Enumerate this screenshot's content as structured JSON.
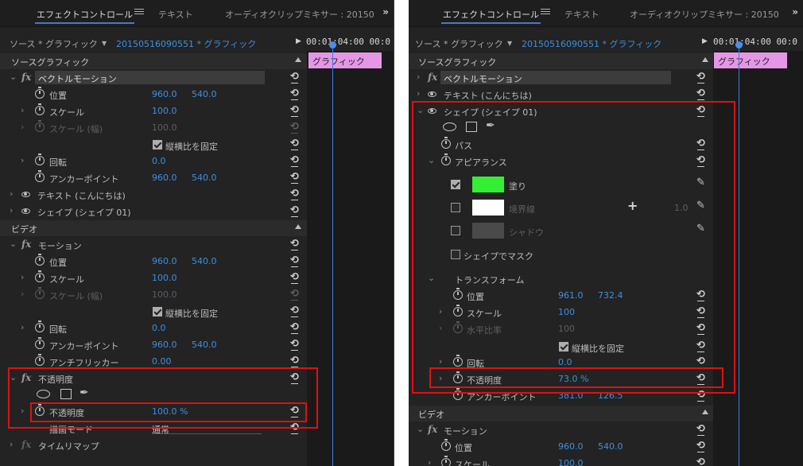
{
  "tabs": {
    "effect_controls": "エフェクトコントロール",
    "text": "テキスト",
    "audio_mixer_left": "オーディオクリップミキサー : 20150",
    "audio_mixer_right": "オーディオクリップミキサー : 20150"
  },
  "source": {
    "prefix": "ソース * グラフィック",
    "clip": "20150516090551 * グラフィック",
    "timecode_left": "00:01:04:00 00:0",
    "timecode_right": "00:01:04:00 00:0"
  },
  "timeline_clip": "グラフィック",
  "left": {
    "source_graphic": "ソースグラフィック",
    "vector_motion": "ベクトルモーション",
    "position": "位置",
    "position_x": "960.0",
    "position_y": "540.0",
    "scale": "スケール",
    "scale_value": "100.0",
    "scale_width": "スケール (幅)",
    "scale_width_value": "100.0",
    "uniform_scale": "縦横比を固定",
    "rotation": "回転",
    "rotation_value": "0.0",
    "anchor": "アンカーポイント",
    "anchor_x": "960.0",
    "anchor_y": "540.0",
    "text_layer": "テキスト (こんにちは)",
    "shape_layer": "シェイプ (シェイプ 01)",
    "video": "ビデオ",
    "motion": "モーション",
    "m_position": "位置",
    "m_position_x": "960.0",
    "m_position_y": "540.0",
    "m_scale": "スケール",
    "m_scale_value": "100.0",
    "m_scale_width": "スケール (幅)",
    "m_scale_width_value": "100.0",
    "m_uniform": "縦横比を固定",
    "m_rotation": "回転",
    "m_rotation_value": "0.0",
    "m_anchor": "アンカーポイント",
    "m_anchor_x": "960.0",
    "m_anchor_y": "540.0",
    "antiflicker": "アンチフリッカー",
    "antiflicker_value": "0.00",
    "opacity_group": "不透明度",
    "opacity": "不透明度",
    "opacity_value": "100.0 %",
    "blend_mode": "描画モード",
    "blend_value": "通常",
    "time_remap": "タイムリマップ"
  },
  "right": {
    "source_graphic": "ソースグラフィック",
    "vector_motion": "ベクトルモーション",
    "text_layer": "テキスト (こんにちは)",
    "shape_layer": "シェイプ (シェイプ 01)",
    "path": "パス",
    "appearance": "アピアランス",
    "fill": "塗り",
    "stroke": "境界線",
    "stroke_width": "1.0",
    "shadow": "シャドウ",
    "shape_mask": "シェイプでマスク",
    "transform": "トランスフォーム",
    "position": "位置",
    "position_x": "961.0",
    "position_y": "732.4",
    "scale": "スケール",
    "scale_value": "100",
    "scale_width": "水平比率",
    "scale_width_value": "100",
    "uniform": "縦横比を固定",
    "rotation": "回転",
    "rotation_value": "0.0",
    "opacity": "不透明度",
    "opacity_value": "73.0 %",
    "anchor": "アンカーポイント",
    "anchor_x": "381.0",
    "anchor_y": "126.5",
    "video": "ビデオ",
    "motion": "モーション",
    "m_position": "位置",
    "m_position_x": "960.0",
    "m_position_y": "540.0",
    "m_scale": "スケール",
    "m_scale_value": "100.0"
  },
  "colors": {
    "accent_blue": "#3f8fe0",
    "clip_pink": "#e596e6",
    "fill_green": "#33ee33",
    "stroke_white": "#ffffff",
    "shadow_gray": "#4a4a4a",
    "highlight_red": "#e01010"
  },
  "icons": [
    "stopwatch-icon",
    "reset-icon",
    "eye-icon",
    "fx-icon",
    "ellipse-tool-icon",
    "rectangle-tool-icon",
    "pen-tool-icon",
    "eyedropper-icon",
    "plus-icon",
    "chevron-icon",
    "panel-menu-icon",
    "overflow-icon",
    "play-icon",
    "collapse-triangle-icon"
  ]
}
